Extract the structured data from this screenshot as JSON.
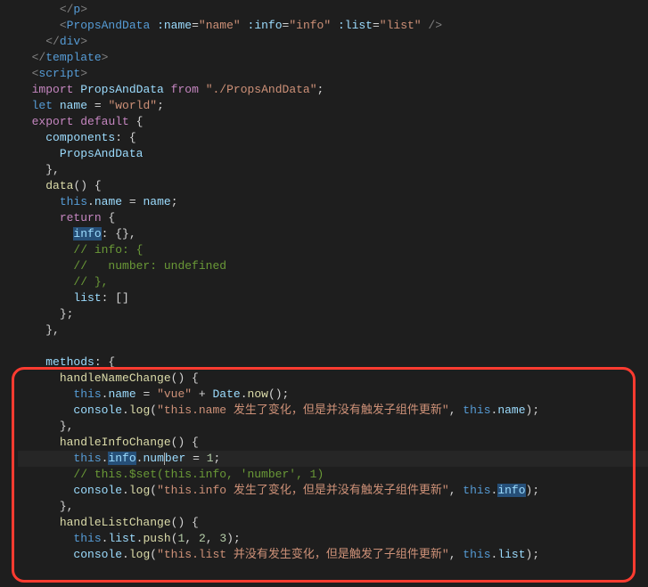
{
  "code": {
    "lines": [
      {
        "indent": 3,
        "tokens": [
          {
            "t": "</",
            "c": "tag"
          },
          {
            "t": "p",
            "c": "tagname"
          },
          {
            "t": ">",
            "c": "tag"
          }
        ]
      },
      {
        "indent": 3,
        "tokens": [
          {
            "t": "<",
            "c": "tag"
          },
          {
            "t": "PropsAndData",
            "c": "tagname"
          },
          {
            "t": " ",
            "c": "plain"
          },
          {
            "t": ":name",
            "c": "attr"
          },
          {
            "t": "=",
            "c": "plain"
          },
          {
            "t": "\"name\"",
            "c": "string"
          },
          {
            "t": " ",
            "c": "plain"
          },
          {
            "t": ":info",
            "c": "attr"
          },
          {
            "t": "=",
            "c": "plain"
          },
          {
            "t": "\"info\"",
            "c": "string"
          },
          {
            "t": " ",
            "c": "plain"
          },
          {
            "t": ":list",
            "c": "attr"
          },
          {
            "t": "=",
            "c": "plain"
          },
          {
            "t": "\"list\"",
            "c": "string"
          },
          {
            "t": " />",
            "c": "tag"
          }
        ]
      },
      {
        "indent": 2,
        "tokens": [
          {
            "t": "</",
            "c": "tag"
          },
          {
            "t": "div",
            "c": "tagname"
          },
          {
            "t": ">",
            "c": "tag"
          }
        ]
      },
      {
        "indent": 1,
        "tokens": [
          {
            "t": "</",
            "c": "tag"
          },
          {
            "t": "template",
            "c": "tagname"
          },
          {
            "t": ">",
            "c": "tag"
          }
        ]
      },
      {
        "indent": 1,
        "tokens": [
          {
            "t": "<",
            "c": "tag"
          },
          {
            "t": "script",
            "c": "tagname"
          },
          {
            "t": ">",
            "c": "tag"
          }
        ]
      },
      {
        "indent": 1,
        "tokens": [
          {
            "t": "import",
            "c": "keyword"
          },
          {
            "t": " ",
            "c": "plain"
          },
          {
            "t": "PropsAndData",
            "c": "ident"
          },
          {
            "t": " ",
            "c": "plain"
          },
          {
            "t": "from",
            "c": "keyword"
          },
          {
            "t": " ",
            "c": "plain"
          },
          {
            "t": "\"./PropsAndData\"",
            "c": "string"
          },
          {
            "t": ";",
            "c": "punct"
          }
        ]
      },
      {
        "indent": 1,
        "tokens": [
          {
            "t": "let",
            "c": "keyword2"
          },
          {
            "t": " ",
            "c": "plain"
          },
          {
            "t": "name",
            "c": "ident"
          },
          {
            "t": " = ",
            "c": "plain"
          },
          {
            "t": "\"world\"",
            "c": "string"
          },
          {
            "t": ";",
            "c": "punct"
          }
        ]
      },
      {
        "indent": 1,
        "tokens": [
          {
            "t": "export",
            "c": "keyword"
          },
          {
            "t": " ",
            "c": "plain"
          },
          {
            "t": "default",
            "c": "keyword"
          },
          {
            "t": " {",
            "c": "punct"
          }
        ]
      },
      {
        "indent": 2,
        "tokens": [
          {
            "t": "components",
            "c": "prop"
          },
          {
            "t": ": {",
            "c": "punct"
          }
        ]
      },
      {
        "indent": 3,
        "tokens": [
          {
            "t": "PropsAndData",
            "c": "ident"
          }
        ]
      },
      {
        "indent": 2,
        "tokens": [
          {
            "t": "},",
            "c": "punct"
          }
        ]
      },
      {
        "indent": 2,
        "tokens": [
          {
            "t": "data",
            "c": "func"
          },
          {
            "t": "() {",
            "c": "punct"
          }
        ]
      },
      {
        "indent": 3,
        "tokens": [
          {
            "t": "this",
            "c": "this"
          },
          {
            "t": ".",
            "c": "punct"
          },
          {
            "t": "name",
            "c": "prop"
          },
          {
            "t": " = ",
            "c": "plain"
          },
          {
            "t": "name",
            "c": "ident"
          },
          {
            "t": ";",
            "c": "punct"
          }
        ]
      },
      {
        "indent": 3,
        "tokens": [
          {
            "t": "return",
            "c": "keyword"
          },
          {
            "t": " {",
            "c": "punct"
          }
        ]
      },
      {
        "indent": 4,
        "tokens": [
          {
            "t": "info",
            "c": "prop sel"
          },
          {
            "t": ": {},",
            "c": "punct"
          }
        ]
      },
      {
        "indent": 4,
        "tokens": [
          {
            "t": "// info: {",
            "c": "comment"
          }
        ]
      },
      {
        "indent": 4,
        "tokens": [
          {
            "t": "//   number: undefined",
            "c": "comment"
          }
        ]
      },
      {
        "indent": 4,
        "tokens": [
          {
            "t": "// },",
            "c": "comment"
          }
        ]
      },
      {
        "indent": 4,
        "tokens": [
          {
            "t": "list",
            "c": "prop"
          },
          {
            "t": ": []",
            "c": "punct"
          }
        ]
      },
      {
        "indent": 3,
        "tokens": [
          {
            "t": "};",
            "c": "punct"
          }
        ]
      },
      {
        "indent": 2,
        "tokens": [
          {
            "t": "},",
            "c": "punct"
          }
        ]
      },
      {
        "indent": 0,
        "tokens": []
      },
      {
        "indent": 2,
        "tokens": [
          {
            "t": "methods",
            "c": "prop"
          },
          {
            "t": ": {",
            "c": "punct"
          }
        ]
      },
      {
        "indent": 3,
        "tokens": [
          {
            "t": "handleNameChange",
            "c": "func"
          },
          {
            "t": "() {",
            "c": "punct"
          }
        ]
      },
      {
        "indent": 4,
        "tokens": [
          {
            "t": "this",
            "c": "this"
          },
          {
            "t": ".",
            "c": "punct"
          },
          {
            "t": "name",
            "c": "prop"
          },
          {
            "t": " = ",
            "c": "plain"
          },
          {
            "t": "\"vue\"",
            "c": "string"
          },
          {
            "t": " + ",
            "c": "plain"
          },
          {
            "t": "Date",
            "c": "ident"
          },
          {
            "t": ".",
            "c": "punct"
          },
          {
            "t": "now",
            "c": "func"
          },
          {
            "t": "();",
            "c": "punct"
          }
        ]
      },
      {
        "indent": 4,
        "tokens": [
          {
            "t": "console",
            "c": "ident"
          },
          {
            "t": ".",
            "c": "punct"
          },
          {
            "t": "log",
            "c": "func"
          },
          {
            "t": "(",
            "c": "punct"
          },
          {
            "t": "\"this.name 发生了变化，但是并没有触发子组件更新\"",
            "c": "string"
          },
          {
            "t": ", ",
            "c": "punct"
          },
          {
            "t": "this",
            "c": "this"
          },
          {
            "t": ".",
            "c": "punct"
          },
          {
            "t": "name",
            "c": "prop"
          },
          {
            "t": ");",
            "c": "punct"
          }
        ]
      },
      {
        "indent": 3,
        "tokens": [
          {
            "t": "},",
            "c": "punct"
          }
        ]
      },
      {
        "indent": 3,
        "tokens": [
          {
            "t": "handleInfoChange",
            "c": "func"
          },
          {
            "t": "() {",
            "c": "punct"
          }
        ]
      },
      {
        "indent": 4,
        "cursor": true,
        "tokens": [
          {
            "t": "this",
            "c": "this"
          },
          {
            "t": ".",
            "c": "punct"
          },
          {
            "t": "info",
            "c": "prop sel"
          },
          {
            "t": ".",
            "c": "punct"
          },
          {
            "t": "nu",
            "c": "prop"
          },
          {
            "t": "m",
            "c": "prop",
            "caret": true
          },
          {
            "t": "ber",
            "c": "prop"
          },
          {
            "t": " = ",
            "c": "plain"
          },
          {
            "t": "1",
            "c": "num"
          },
          {
            "t": ";",
            "c": "punct"
          }
        ]
      },
      {
        "indent": 4,
        "tokens": [
          {
            "t": "// this.$set(this.info, 'number', 1)",
            "c": "comment"
          }
        ]
      },
      {
        "indent": 4,
        "tokens": [
          {
            "t": "console",
            "c": "ident"
          },
          {
            "t": ".",
            "c": "punct"
          },
          {
            "t": "log",
            "c": "func"
          },
          {
            "t": "(",
            "c": "punct"
          },
          {
            "t": "\"this.info 发生了变化，但是并没有触发子组件更新\"",
            "c": "string"
          },
          {
            "t": ", ",
            "c": "punct"
          },
          {
            "t": "this",
            "c": "this"
          },
          {
            "t": ".",
            "c": "punct"
          },
          {
            "t": "info",
            "c": "prop sel"
          },
          {
            "t": ");",
            "c": "punct"
          }
        ]
      },
      {
        "indent": 3,
        "tokens": [
          {
            "t": "},",
            "c": "punct"
          }
        ]
      },
      {
        "indent": 3,
        "tokens": [
          {
            "t": "handleListChange",
            "c": "func"
          },
          {
            "t": "() {",
            "c": "punct"
          }
        ]
      },
      {
        "indent": 4,
        "tokens": [
          {
            "t": "this",
            "c": "this"
          },
          {
            "t": ".",
            "c": "punct"
          },
          {
            "t": "list",
            "c": "prop"
          },
          {
            "t": ".",
            "c": "punct"
          },
          {
            "t": "push",
            "c": "func"
          },
          {
            "t": "(",
            "c": "punct"
          },
          {
            "t": "1",
            "c": "num"
          },
          {
            "t": ", ",
            "c": "punct"
          },
          {
            "t": "2",
            "c": "num"
          },
          {
            "t": ", ",
            "c": "punct"
          },
          {
            "t": "3",
            "c": "num"
          },
          {
            "t": ");",
            "c": "punct"
          }
        ]
      },
      {
        "indent": 4,
        "tokens": [
          {
            "t": "console",
            "c": "ident"
          },
          {
            "t": ".",
            "c": "punct"
          },
          {
            "t": "log",
            "c": "func"
          },
          {
            "t": "(",
            "c": "punct"
          },
          {
            "t": "\"this.list 并没有发生变化，但是触发了子组件更新\"",
            "c": "string"
          },
          {
            "t": ", ",
            "c": "punct"
          },
          {
            "t": "this",
            "c": "this"
          },
          {
            "t": ".",
            "c": "punct"
          },
          {
            "t": "list",
            "c": "prop"
          },
          {
            "t": ");",
            "c": "punct"
          }
        ]
      }
    ]
  },
  "highlight": {
    "present": true
  }
}
